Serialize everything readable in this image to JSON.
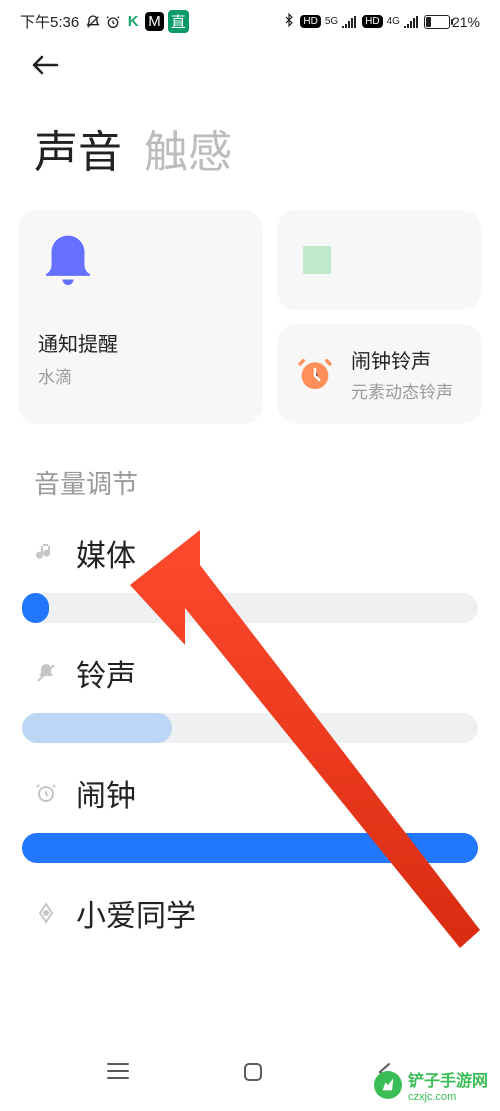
{
  "status": {
    "time": "下午5:36",
    "battery_pct": "21%"
  },
  "tabs": {
    "sound": "声音",
    "haptics": "触感"
  },
  "cards": {
    "notify": {
      "title": "通知提醒",
      "sub": "水滴"
    },
    "alarm": {
      "title": "闹钟铃声",
      "sub": "元素动态铃声"
    }
  },
  "section_volume": "音量调节",
  "sliders": {
    "media": {
      "label": "媒体",
      "percent": 6
    },
    "ring": {
      "label": "铃声",
      "percent": 33
    },
    "alarm": {
      "label": "闹钟",
      "percent": 100
    },
    "xiaoai": {
      "label": "小爱同学"
    }
  },
  "watermark": {
    "url": "czxjc.com",
    "brand": "铲子手游网"
  }
}
